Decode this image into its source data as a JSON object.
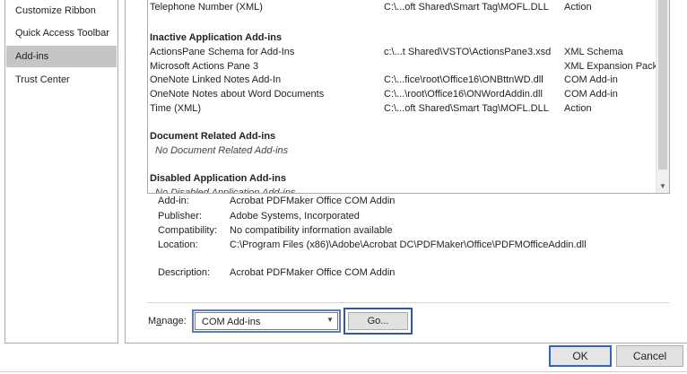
{
  "sidebar": {
    "items": [
      {
        "label": "Customize Ribbon"
      },
      {
        "label": "Quick Access Toolbar"
      },
      {
        "label": "Add-ins"
      },
      {
        "label": "Trust Center"
      }
    ]
  },
  "addins": {
    "top_row": {
      "name": "Telephone Number (XML)",
      "location": "C:\\...oft Shared\\Smart Tag\\MOFL.DLL",
      "type": "Action"
    },
    "inactive_header": "Inactive Application Add-ins",
    "inactive": [
      {
        "name": "ActionsPane Schema for Add-Ins",
        "location": "c:\\...t Shared\\VSTO\\ActionsPane3.xsd",
        "type": "XML Schema"
      },
      {
        "name": "Microsoft Actions Pane 3",
        "location": "",
        "type": "XML Expansion Pack"
      },
      {
        "name": "OneNote Linked Notes Add-In",
        "location": "C:\\...fice\\root\\Office16\\ONBttnWD.dll",
        "type": "COM Add-in"
      },
      {
        "name": "OneNote Notes about Word Documents",
        "location": "C:\\...\\root\\Office16\\ONWordAddin.dll",
        "type": "COM Add-in"
      },
      {
        "name": "Time (XML)",
        "location": "C:\\...oft Shared\\Smart Tag\\MOFL.DLL",
        "type": "Action"
      }
    ],
    "document_header": "Document Related Add-ins",
    "document_empty": "No Document Related Add-ins",
    "disabled_header": "Disabled Application Add-ins",
    "disabled_empty": "No Disabled Application Add-ins"
  },
  "details": {
    "addin_label": "Add-in:",
    "addin_value": "Acrobat PDFMaker Office COM Addin",
    "publisher_label": "Publisher:",
    "publisher_value": "Adobe Systems, Incorporated",
    "compat_label": "Compatibility:",
    "compat_value": "No compatibility information available",
    "location_label": "Location:",
    "location_value": "C:\\Program Files (x86)\\Adobe\\Acrobat DC\\PDFMaker\\Office\\PDFMOfficeAddin.dll",
    "description_label": "Description:",
    "description_value": "Acrobat PDFMaker Office COM Addin"
  },
  "manage": {
    "label_prefix": "M",
    "label_underlined": "a",
    "label_suffix": "nage:",
    "selected": "COM Add-ins",
    "go_label": "Go..."
  },
  "footer": {
    "ok_label": "OK",
    "cancel_label": "Cancel"
  }
}
